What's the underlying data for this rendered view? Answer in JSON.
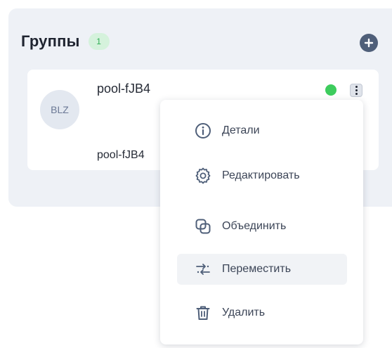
{
  "groups": {
    "title": "Группы",
    "count": "1",
    "add_icon": "plus-circle-icon",
    "accent_color": "#3dcc5d"
  },
  "group_card": {
    "avatar_initials": "BLZ",
    "name": "pool-fJB4",
    "subtitle": "pool-fJB4",
    "status": "active",
    "status_color": "#3dcc5d",
    "more_icon": "more-vertical-icon"
  },
  "context_menu": {
    "items": [
      {
        "label": "Детали",
        "icon": "info-icon"
      },
      {
        "label": "Редактировать",
        "icon": "gear-icon"
      },
      {
        "label": "Объединить",
        "icon": "merge-icon"
      },
      {
        "label": "Переместить",
        "icon": "move-arrows-icon",
        "highlighted": true
      },
      {
        "label": "Удалить",
        "icon": "trash-icon"
      }
    ]
  }
}
